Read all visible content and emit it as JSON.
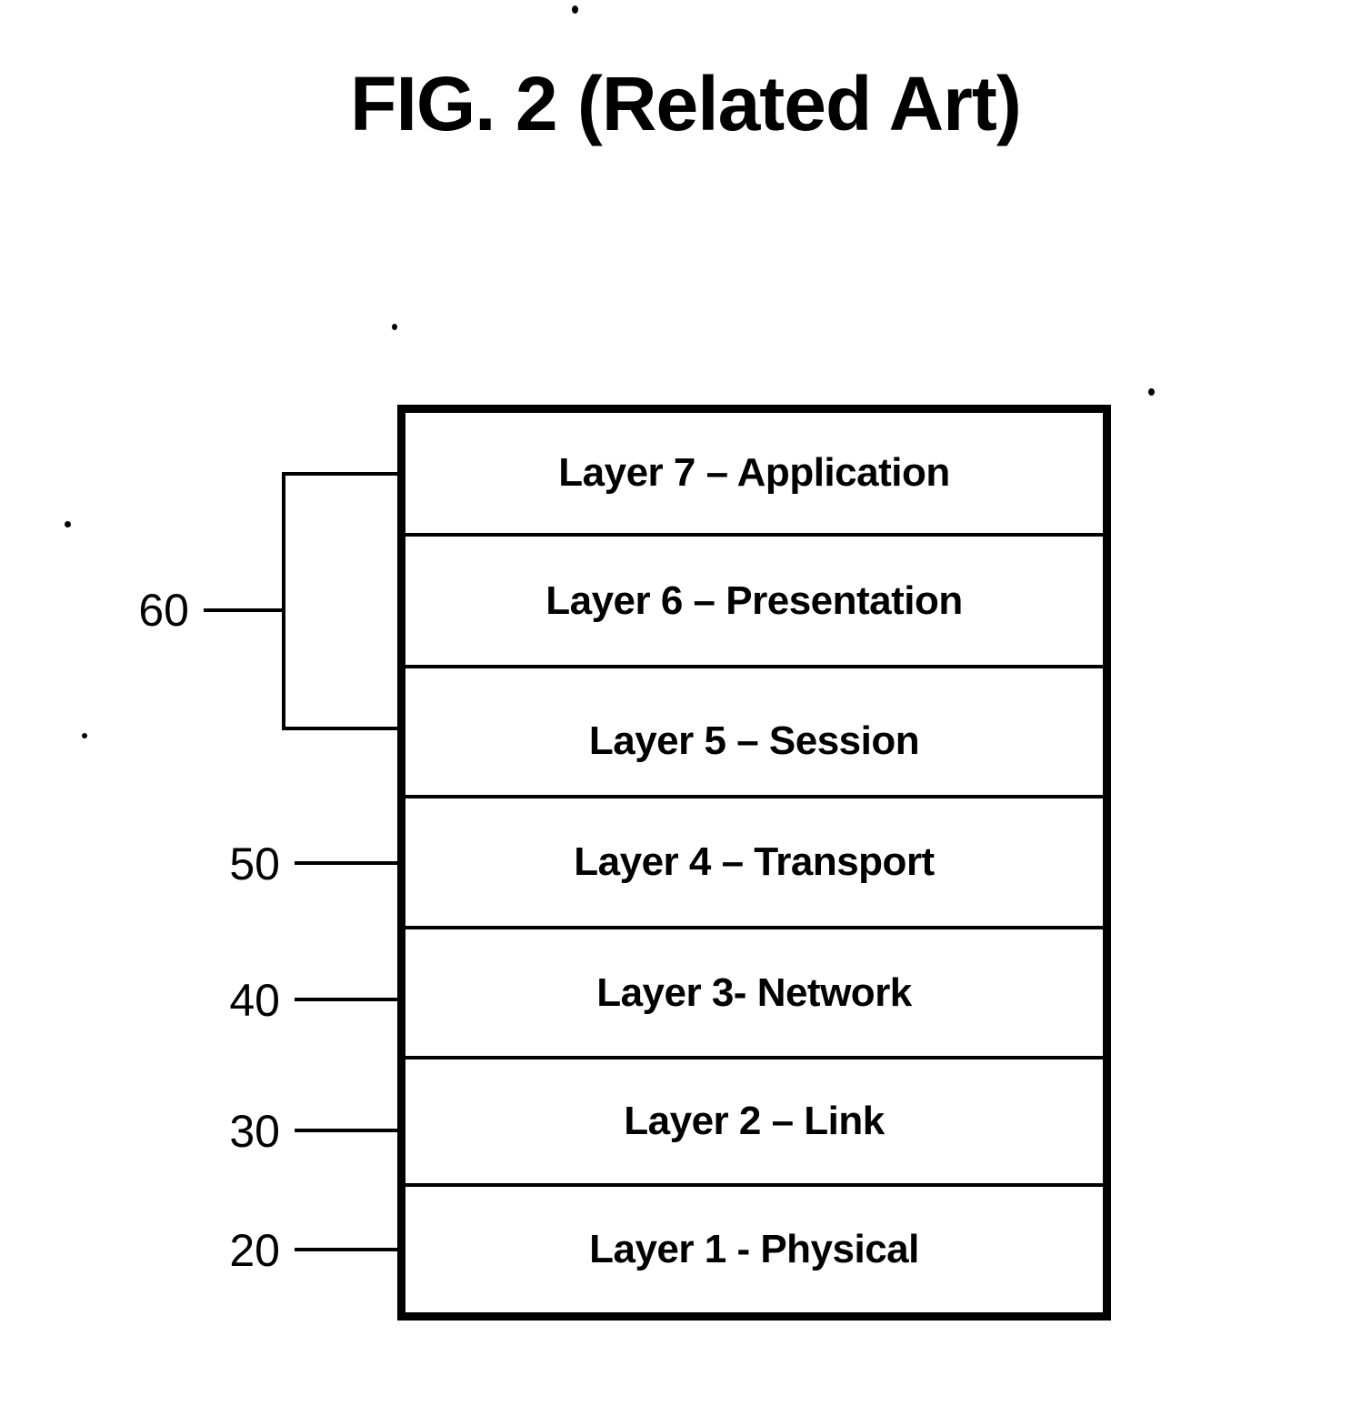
{
  "figure": {
    "title": "FIG. 2 (Related Art)",
    "layers": [
      {
        "label": "Layer 7 – Application",
        "number": 7,
        "name": "Application"
      },
      {
        "label": "Layer 6 – Presentation",
        "number": 6,
        "name": "Presentation"
      },
      {
        "label": "Layer 5 – Session",
        "number": 5,
        "name": "Session"
      },
      {
        "label": "Layer 4 – Transport",
        "number": 4,
        "name": "Transport"
      },
      {
        "label": "Layer 3- Network",
        "number": 3,
        "name": "Network"
      },
      {
        "label": "Layer 2 – Link",
        "number": 2,
        "name": "Link"
      },
      {
        "label": "Layer 1 - Physical",
        "number": 1,
        "name": "Physical"
      }
    ],
    "reference_numerals": [
      {
        "value": "60",
        "refers_to": "Layers 7, 6 and 5 (bracketed group)"
      },
      {
        "value": "50",
        "refers_to": "Layer 4 – Transport"
      },
      {
        "value": "40",
        "refers_to": "Layer 3- Network"
      },
      {
        "value": "30",
        "refers_to": "Layer 2 – Link"
      },
      {
        "value": "20",
        "refers_to": "Layer 1 - Physical"
      }
    ],
    "colors": {
      "ink": "#000000",
      "paper": "#ffffff"
    }
  }
}
